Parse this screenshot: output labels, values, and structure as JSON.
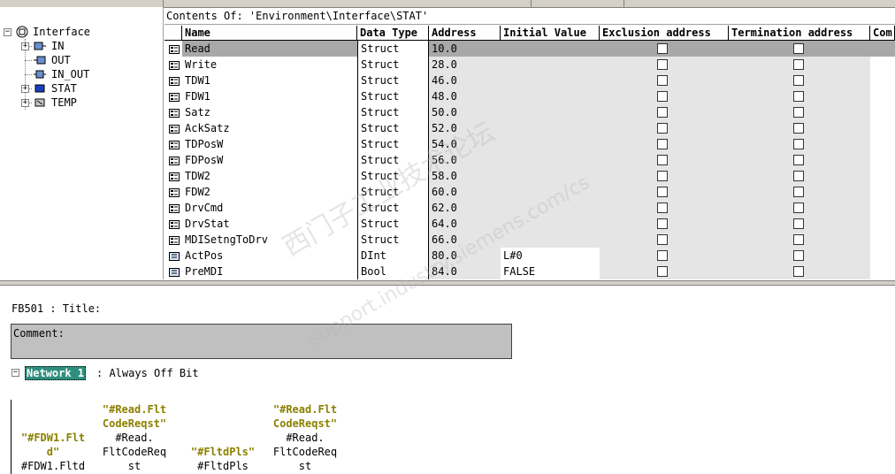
{
  "tree": {
    "root": "Interface",
    "items": [
      "IN",
      "OUT",
      "IN_OUT",
      "STAT",
      "TEMP"
    ]
  },
  "contents_label": "Contents Of: 'Environment\\Interface\\STAT'",
  "columns": [
    "Name",
    "Data Type",
    "Address",
    "Initial Value",
    "Exclusion address",
    "Termination address",
    "Com"
  ],
  "rows": [
    {
      "name": "Read",
      "type": "Struct",
      "address": "10.0",
      "initial": ""
    },
    {
      "name": "Write",
      "type": "Struct",
      "address": "28.0",
      "initial": ""
    },
    {
      "name": "TDW1",
      "type": "Struct",
      "address": "46.0",
      "initial": ""
    },
    {
      "name": "FDW1",
      "type": "Struct",
      "address": "48.0",
      "initial": ""
    },
    {
      "name": "Satz",
      "type": "Struct",
      "address": "50.0",
      "initial": ""
    },
    {
      "name": "AckSatz",
      "type": "Struct",
      "address": "52.0",
      "initial": ""
    },
    {
      "name": "TDPosW",
      "type": "Struct",
      "address": "54.0",
      "initial": ""
    },
    {
      "name": "FDPosW",
      "type": "Struct",
      "address": "56.0",
      "initial": ""
    },
    {
      "name": "TDW2",
      "type": "Struct",
      "address": "58.0",
      "initial": ""
    },
    {
      "name": "FDW2",
      "type": "Struct",
      "address": "60.0",
      "initial": ""
    },
    {
      "name": "DrvCmd",
      "type": "Struct",
      "address": "62.0",
      "initial": ""
    },
    {
      "name": "DrvStat",
      "type": "Struct",
      "address": "64.0",
      "initial": ""
    },
    {
      "name": "MDISetngToDrv",
      "type": "Struct",
      "address": "66.0",
      "initial": ""
    },
    {
      "name": "ActPos",
      "type": "DInt",
      "address": "80.0",
      "initial": "L#0"
    },
    {
      "name": "PreMDI",
      "type": "Bool",
      "address": "84.0",
      "initial": "FALSE"
    }
  ],
  "fb_title": "FB501 : Title:",
  "comment_label": "Comment:",
  "network": {
    "label": "Network 1",
    "title": ": Always Off Bit"
  },
  "operands": [
    {
      "symbol": [
        "\"#FDW1.Flt",
        "d\""
      ],
      "address": [
        "#FDW1.Fltd"
      ]
    },
    {
      "symbol": [
        "\"#Read.Flt",
        "CodeReqst\""
      ],
      "address": [
        "#Read.",
        "FltCodeReq",
        "st"
      ]
    },
    {
      "symbol": [
        "\"#FltdPls\""
      ],
      "address": [
        "#FltdPls"
      ]
    },
    {
      "symbol": [
        "\"#Read.Flt",
        "CodeReqst\""
      ],
      "address": [
        "#Read.",
        "FltCodeReq",
        "st"
      ]
    }
  ],
  "watermark": [
    "西门子工业技术论坛",
    "support.industry.siemens.com/cs"
  ],
  "colors": {
    "selected_row": "#a8a8a8",
    "network_badge": "#2f8f7f",
    "symbol_text": "#8b8000",
    "readonly_cell": "#e5e5e5"
  }
}
